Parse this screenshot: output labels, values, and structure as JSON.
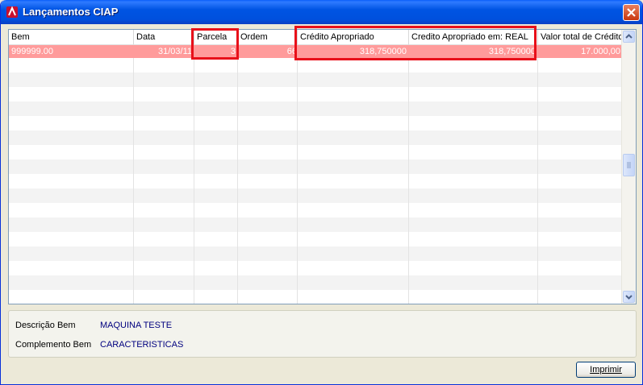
{
  "window": {
    "title": "Lançamentos CIAP"
  },
  "grid": {
    "columns": [
      "Bem",
      "Data",
      "Parcela",
      "Ordem",
      "Crédito Apropriado",
      "Credito Apropriado em: REAL",
      "Valor total de Crédito"
    ],
    "selected_row": [
      "999999.00",
      "31/03/11",
      "3",
      "66",
      "318,750000",
      "318,750000",
      "17.000,00"
    ]
  },
  "info": {
    "descricao_label": "Descrição Bem",
    "descricao_value": "MAQUINA TESTE",
    "complemento_label": "Complemento Bem",
    "complemento_value": "CARACTERISTICAS"
  },
  "buttons": {
    "print": "Imprimir"
  },
  "colors": {
    "selected_row": "#ff9b9b",
    "highlight_box": "#e8101a",
    "title_bar": "#0054e3"
  }
}
